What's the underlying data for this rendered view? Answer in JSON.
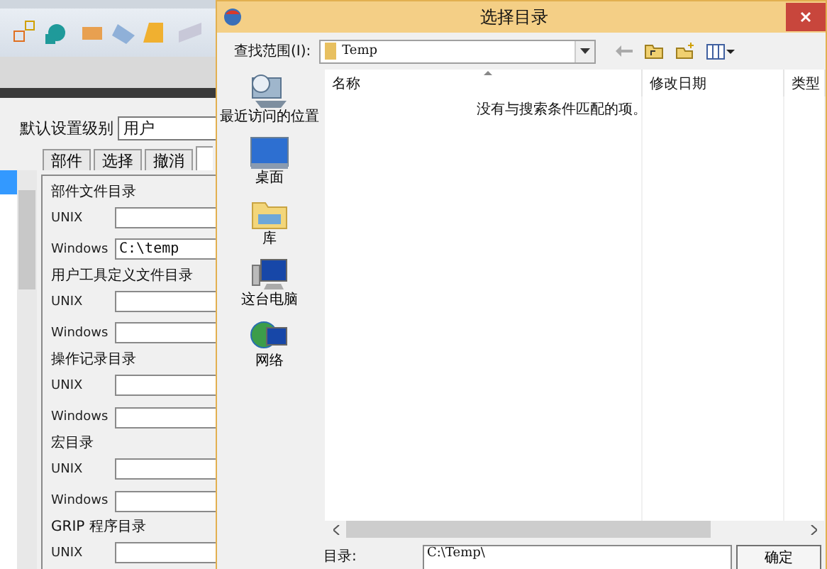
{
  "app": {
    "settings": {
      "level_label": "默认设置级别",
      "level_value": "用户"
    },
    "tabs": [
      {
        "label": "部件",
        "selected": false
      },
      {
        "label": "选择",
        "selected": false
      },
      {
        "label": "撤消",
        "selected": false
      }
    ],
    "groups": [
      {
        "title": "部件文件目录",
        "fields": [
          {
            "label": "UNIX"
          },
          {
            "label": "Windows",
            "value": "C:\\temp"
          }
        ]
      },
      {
        "title": "用户工具定义文件目录",
        "fields": [
          {
            "label": "UNIX"
          },
          {
            "label": "Windows"
          }
        ]
      },
      {
        "title": "操作记录目录",
        "fields": [
          {
            "label": "UNIX"
          },
          {
            "label": "Windows"
          }
        ]
      },
      {
        "title": "宏目录",
        "fields": [
          {
            "label": "UNIX"
          },
          {
            "label": "Windows"
          }
        ]
      },
      {
        "title": "GRIP 程序目录",
        "fields": [
          {
            "label": "UNIX"
          }
        ]
      }
    ]
  },
  "dialog": {
    "title": "选择目录",
    "look_in_label": "查找范围(I):",
    "look_in_value": "Temp",
    "places": [
      {
        "kind": "recent",
        "label": "最近访问的位置"
      },
      {
        "kind": "desktop",
        "label": "桌面"
      },
      {
        "kind": "library",
        "label": "库"
      },
      {
        "kind": "computer",
        "label": "这台电脑"
      },
      {
        "kind": "network",
        "label": "网络"
      }
    ],
    "columns": [
      "名称",
      "修改日期",
      "类型"
    ],
    "empty_message": "没有与搜索条件匹配的项。",
    "dir_label": "目录:",
    "dir_value": "C:\\Temp\\",
    "ok_button": "确定"
  }
}
